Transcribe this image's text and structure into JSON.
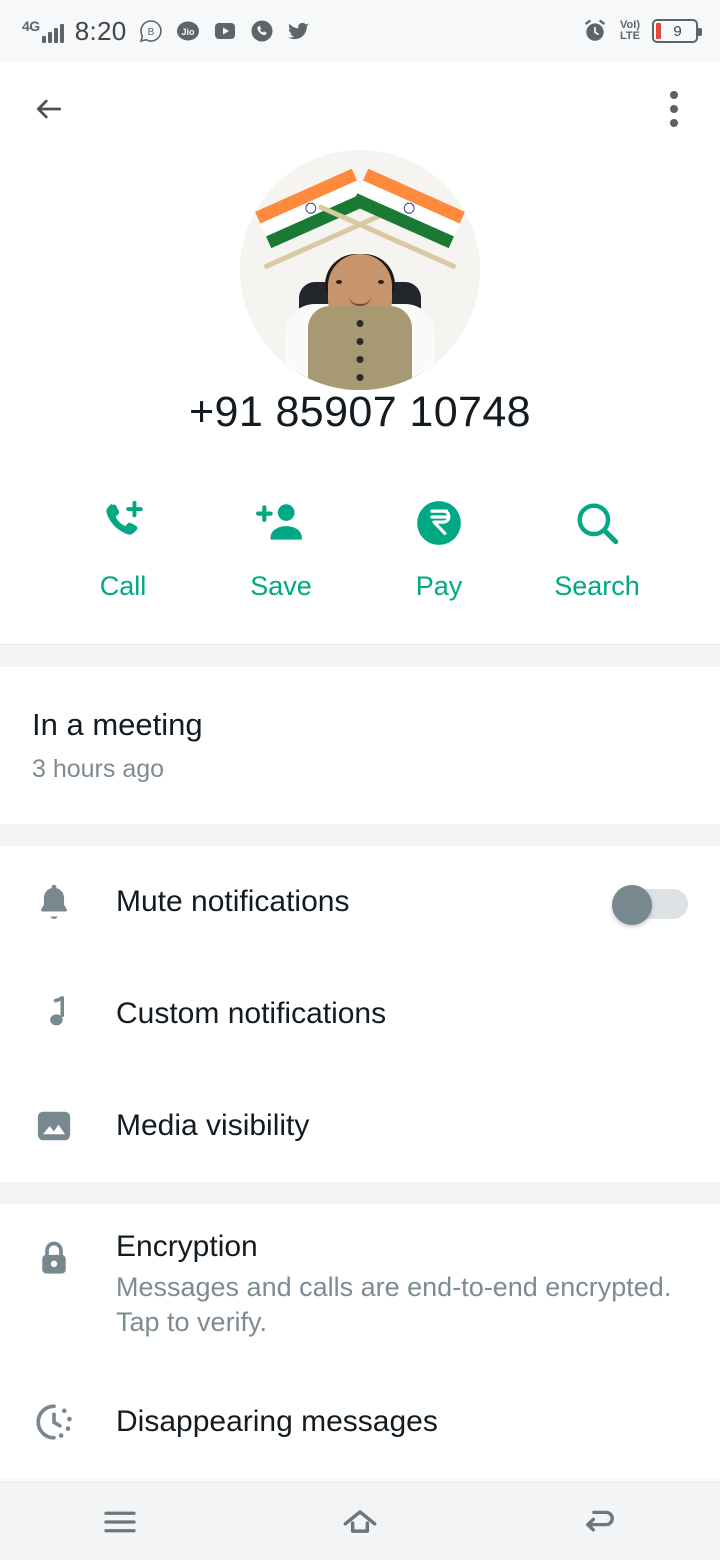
{
  "statusbar": {
    "network_type": "4G",
    "time": "8:20",
    "notification_icons": [
      "chat-b-icon",
      "jio-icon",
      "youtube-icon",
      "phone-call-icon",
      "twitter-icon"
    ],
    "alarm_icon": "alarm-clock-icon",
    "volte_line1": "VoI)",
    "volte_line2": "LTE",
    "battery_percent": "9"
  },
  "header": {
    "back_icon": "back-arrow-icon",
    "overflow_icon": "more-vertical-icon",
    "avatar_alt": "contact-profile-photo",
    "phone_number": "+91 85907 10748"
  },
  "actions": [
    {
      "id": "call",
      "label": "Call",
      "icon": "phone-add-icon"
    },
    {
      "id": "save",
      "label": "Save",
      "icon": "person-add-icon"
    },
    {
      "id": "pay",
      "label": "Pay",
      "icon": "rupee-circle-icon"
    },
    {
      "id": "search",
      "label": "Search",
      "icon": "search-icon"
    }
  ],
  "status": {
    "text": "In a meeting",
    "timestamp": "3 hours ago"
  },
  "settings": [
    {
      "id": "mute",
      "title": "Mute notifications",
      "icon": "bell-icon",
      "toggle": "off"
    },
    {
      "id": "custom-notifications",
      "title": "Custom notifications",
      "icon": "music-note-icon"
    },
    {
      "id": "media-visibility",
      "title": "Media visibility",
      "icon": "image-icon"
    }
  ],
  "privacy": [
    {
      "id": "encryption",
      "title": "Encryption",
      "subtitle": "Messages and calls are end-to-end encrypted. Tap to verify.",
      "icon": "lock-icon"
    },
    {
      "id": "disappearing-messages",
      "title": "Disappearing messages",
      "icon": "timer-icon"
    }
  ],
  "navbar": {
    "recents_icon": "menu-icon",
    "home_icon": "home-icon",
    "back_icon": "back-nav-icon"
  },
  "colors": {
    "accent": "#00A884",
    "text_primary": "#111B21",
    "text_secondary": "#7D8B93",
    "icon_gray": "#78888F",
    "background": "#FFFFFF",
    "section_gap": "#F2F4F6",
    "battery_low": "#E8453C"
  }
}
